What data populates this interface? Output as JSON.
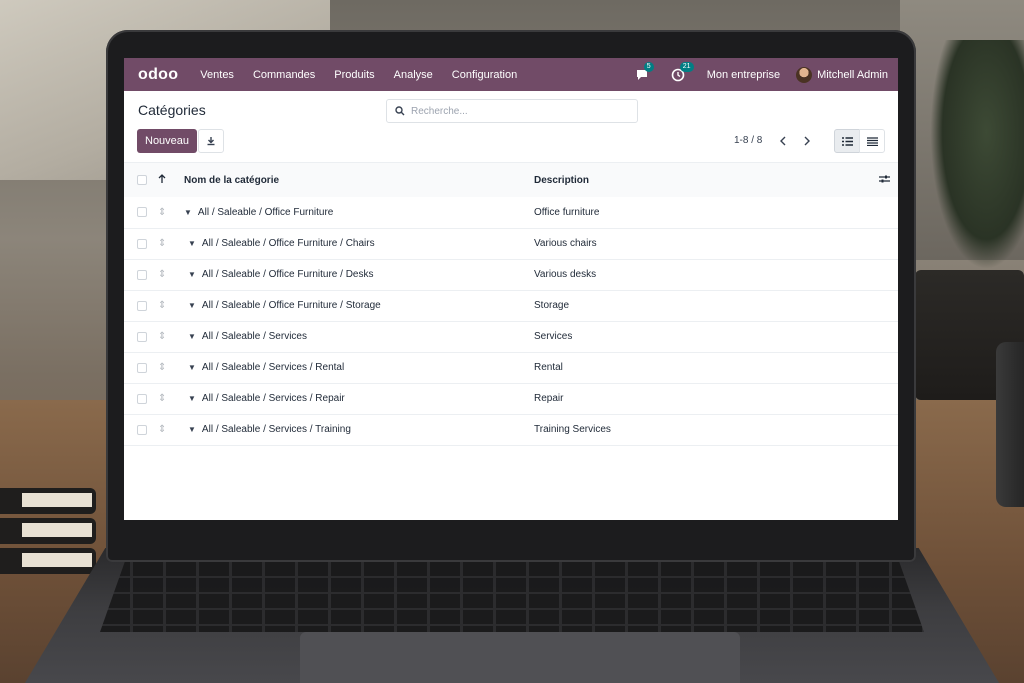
{
  "topbar": {
    "logo": "odoo",
    "menu": [
      "Ventes",
      "Commandes",
      "Produits",
      "Analyse",
      "Configuration"
    ],
    "messages_badge": "5",
    "activities_badge": "21",
    "company": "Mon entreprise",
    "user": "Mitchell Admin"
  },
  "control": {
    "title": "Catégories",
    "search_placeholder": "Recherche...",
    "new_button": "Nouveau",
    "pager": "1-8 / 8"
  },
  "table": {
    "columns": {
      "name": "Nom de la catégorie",
      "description": "Description"
    },
    "rows": [
      {
        "name": "All / Saleable / Office Furniture",
        "description": "Office furniture"
      },
      {
        "name": "All / Saleable / Office Furniture / Chairs",
        "description": "Various chairs"
      },
      {
        "name": "All / Saleable / Office Furniture / Desks",
        "description": "Various desks"
      },
      {
        "name": "All / Saleable / Office Furniture / Storage",
        "description": "Storage"
      },
      {
        "name": "All / Saleable / Services",
        "description": "Services"
      },
      {
        "name": "All / Saleable / Services / Rental",
        "description": "Rental"
      },
      {
        "name": "All / Saleable / Services / Repair",
        "description": "Repair"
      },
      {
        "name": "All / Saleable / Services / Training",
        "description": "Training Services"
      }
    ]
  },
  "colors": {
    "brand": "#714b67",
    "badge": "#017e84"
  }
}
